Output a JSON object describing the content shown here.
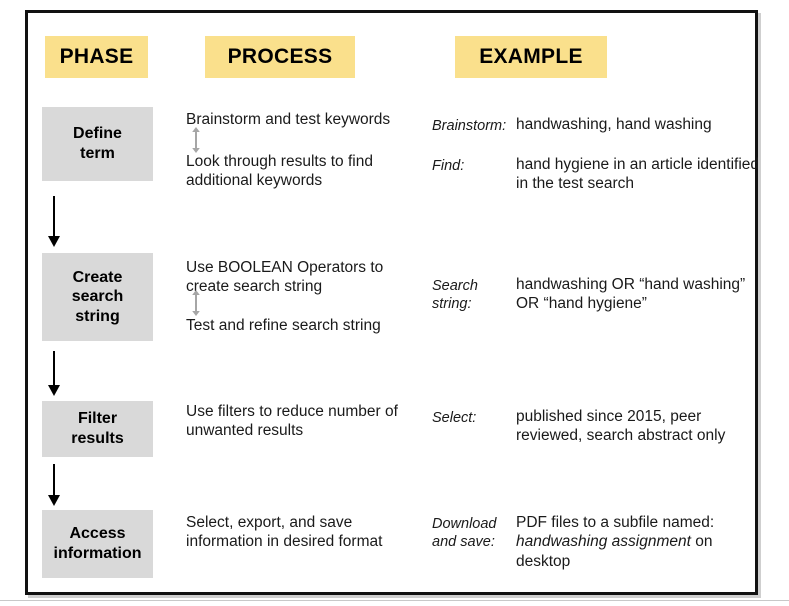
{
  "headers": {
    "phase": "PHASE",
    "process": "PROCESS",
    "example": "EXAMPLE"
  },
  "colors": {
    "header_chip": "#fae08c",
    "phase_box": "#d9d9d9",
    "arrow": "#000000",
    "double_arrow": "#a6a6a6",
    "frame_border": "#111111"
  },
  "phases": [
    {
      "label": "Define\nterm"
    },
    {
      "label": "Create\nsearch\nstring"
    },
    {
      "label": "Filter\nresults"
    },
    {
      "label": "Access\ninformation"
    }
  ],
  "process": {
    "row0_top": "Brainstorm and test keywords",
    "row0_bottom": "Look through results to find additional keywords",
    "row1_top": "Use BOOLEAN Operators to create search string",
    "row1_bottom": "Test and refine search string",
    "row2": "Use filters to reduce number of unwanted results",
    "row3": "Select, export, and save information in desired format"
  },
  "example": {
    "row0_label": "Brainstorm:",
    "row0_value": "handwashing, hand washing",
    "row1_label": "Find:",
    "row1_value": "hand hygiene in an article identified in the test search",
    "row2_label": "Search string:",
    "row2_value": "handwashing OR “hand washing” OR “hand hygiene”",
    "row3_label": "Select:",
    "row3_value": "published since 2015, peer reviewed, search abstract only",
    "row4_label": "Download and save:",
    "row4_value_pre": "PDF files to a subfile named: ",
    "row4_value_italic": "handwashing assignment",
    "row4_value_post": " on desktop"
  },
  "icons": {
    "flow_arrow": "arrow-down-icon",
    "double_arrow": "arrow-up-down-icon"
  }
}
